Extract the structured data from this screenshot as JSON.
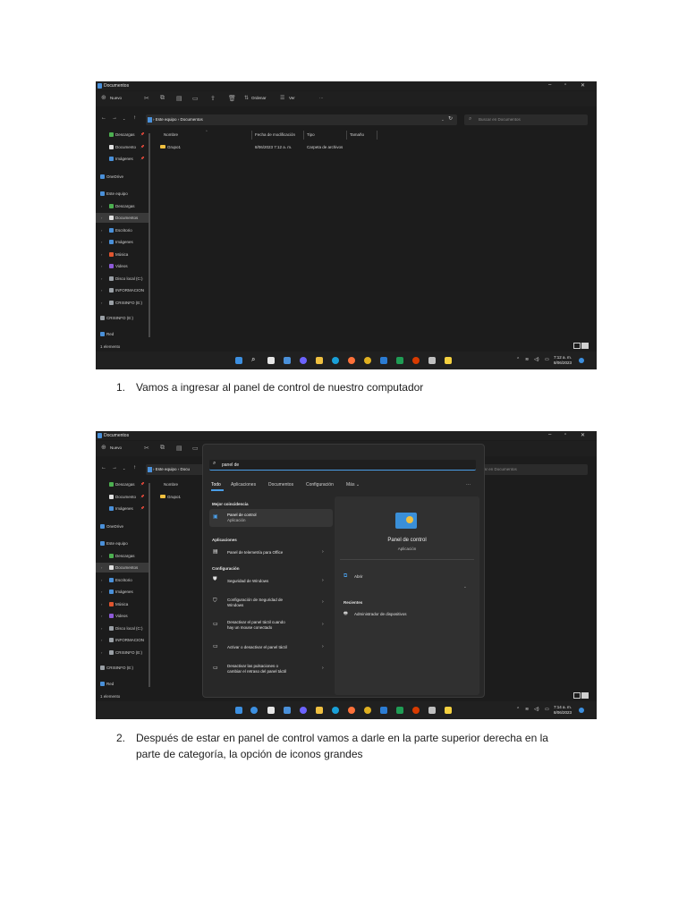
{
  "screenshots": [
    {
      "window_title": "Documentos",
      "commands": {
        "new": "Nuevo",
        "sort": "Ordenar",
        "view": "Ver",
        "more": "···"
      },
      "breadcrumb": "› Este equipo › Documentos",
      "search_placeholder": "Buscar en Documentos",
      "sidebar": [
        {
          "label": "Descargas",
          "pin": "📌",
          "color": "#4caf50",
          "indent": 1
        },
        {
          "label": "Documento",
          "pin": "📌",
          "color": "#e0e0e0",
          "indent": 1
        },
        {
          "label": "Imágenes",
          "pin": "📌",
          "color": "#4a90d9",
          "indent": 1
        },
        {
          "label": "OneDrive",
          "color": "#4a90d9",
          "indent": 0
        },
        {
          "label": "Este equipo",
          "color": "#4a90d9",
          "indent": 0
        },
        {
          "label": "Descargas",
          "color": "#4caf50",
          "indent": 1
        },
        {
          "label": "Documentos",
          "color": "#e0e0e0",
          "indent": 1,
          "selected": true
        },
        {
          "label": "Escritorio",
          "color": "#4a90d9",
          "indent": 1
        },
        {
          "label": "Imágenes",
          "color": "#4a90d9",
          "indent": 1
        },
        {
          "label": "Música",
          "color": "#e0552f",
          "indent": 1
        },
        {
          "label": "Videos",
          "color": "#8e5ad8",
          "indent": 1
        },
        {
          "label": "Disco local (C:)",
          "color": "#9aa0a6",
          "indent": 1
        },
        {
          "label": "INFORMACION",
          "color": "#9aa0a6",
          "indent": 1
        },
        {
          "label": "CRISINFO (E:)",
          "color": "#9aa0a6",
          "indent": 1
        },
        {
          "label": "CRISINFO (E:)",
          "color": "#9aa0a6",
          "indent": 0
        },
        {
          "label": "Red",
          "color": "#4a90d9",
          "indent": 0
        }
      ],
      "columns": [
        "Nombre",
        "Fecha de modificación",
        "Tipo",
        "Tamaño"
      ],
      "rows": [
        {
          "name": "Grupo1",
          "date": "8/06/2023 7:12 a. m.",
          "type": "Carpeta de archivos",
          "size": ""
        }
      ],
      "status": "1 elemento",
      "clock": {
        "time": "7:12 a. m.",
        "date": "8/06/2023"
      }
    },
    {
      "window_title": "Documentos",
      "commands": {
        "new": "Nuevo"
      },
      "breadcrumb": "› Este equipo › Docu",
      "search_placeholder": "ar en Documentos",
      "sidebar": [
        {
          "label": "Descargas",
          "pin": "📌",
          "color": "#4caf50",
          "indent": 1
        },
        {
          "label": "Documento",
          "pin": "📌",
          "color": "#e0e0e0",
          "indent": 1
        },
        {
          "label": "Imágenes",
          "pin": "📌",
          "color": "#4a90d9",
          "indent": 1
        },
        {
          "label": "OneDrive",
          "color": "#4a90d9",
          "indent": 0
        },
        {
          "label": "Este equipo",
          "color": "#4a90d9",
          "indent": 0
        },
        {
          "label": "Descargas",
          "color": "#4caf50",
          "indent": 1
        },
        {
          "label": "Documentos",
          "color": "#e0e0e0",
          "indent": 1,
          "selected": true
        },
        {
          "label": "Escritorio",
          "color": "#4a90d9",
          "indent": 1
        },
        {
          "label": "Imágenes",
          "color": "#4a90d9",
          "indent": 1
        },
        {
          "label": "Música",
          "color": "#e0552f",
          "indent": 1
        },
        {
          "label": "Videos",
          "color": "#8e5ad8",
          "indent": 1
        },
        {
          "label": "Disco local (C:)",
          "color": "#9aa0a6",
          "indent": 1
        },
        {
          "label": "INFORMACION",
          "color": "#9aa0a6",
          "indent": 1
        },
        {
          "label": "CRISINFO (E:)",
          "color": "#9aa0a6",
          "indent": 1
        },
        {
          "label": "CRISINFO (E:)",
          "color": "#9aa0a6",
          "indent": 0
        },
        {
          "label": "Red",
          "color": "#4a90d9",
          "indent": 0
        }
      ],
      "columns": [
        "Nombre"
      ],
      "rows": [
        {
          "name": "Grupo1"
        }
      ],
      "status": "1 elemento",
      "clock": {
        "time": "7:14 a. m.",
        "date": "8/06/2023"
      },
      "search": {
        "query": "panel de",
        "tabs": [
          "Todo",
          "Aplicaciones",
          "Documentos",
          "Configuración",
          "Más ⌄",
          "···"
        ],
        "best_match_header": "Mejor coincidencia",
        "best_match": {
          "title": "Panel de control",
          "subtitle": "Aplicación"
        },
        "apps_header": "Aplicaciones",
        "apps": [
          {
            "title": "Panel de telemetría para Office"
          }
        ],
        "settings_header": "Configuración",
        "settings": [
          {
            "line1": "Seguridad de Windows",
            "line2": ""
          },
          {
            "line1": "Configuración de Seguridad de",
            "line2": "Windows"
          },
          {
            "line1": "Desactivar el panel táctil cuando",
            "line2": "hay un mouse conectado"
          },
          {
            "line1": "Activar o desactivar el panel táctil",
            "line2": ""
          },
          {
            "line1": "Desactivar las pulsaciones o",
            "line2": "cambiar el retraso del panel táctil"
          }
        ],
        "preview": {
          "title": "Panel de control",
          "subtitle": "Aplicación",
          "open": "Abrir",
          "recent_header": "Recientes",
          "recent_item": "Administrador de dispositivos"
        }
      }
    }
  ],
  "steps": [
    {
      "number": "1.",
      "text": "Vamos a ingresar al panel de control de nuestro computador"
    },
    {
      "number": "2.",
      "text": "Después de estar en panel de control vamos a darle en la parte superior derecha en la parte de categoría, la opción de iconos grandes"
    }
  ]
}
